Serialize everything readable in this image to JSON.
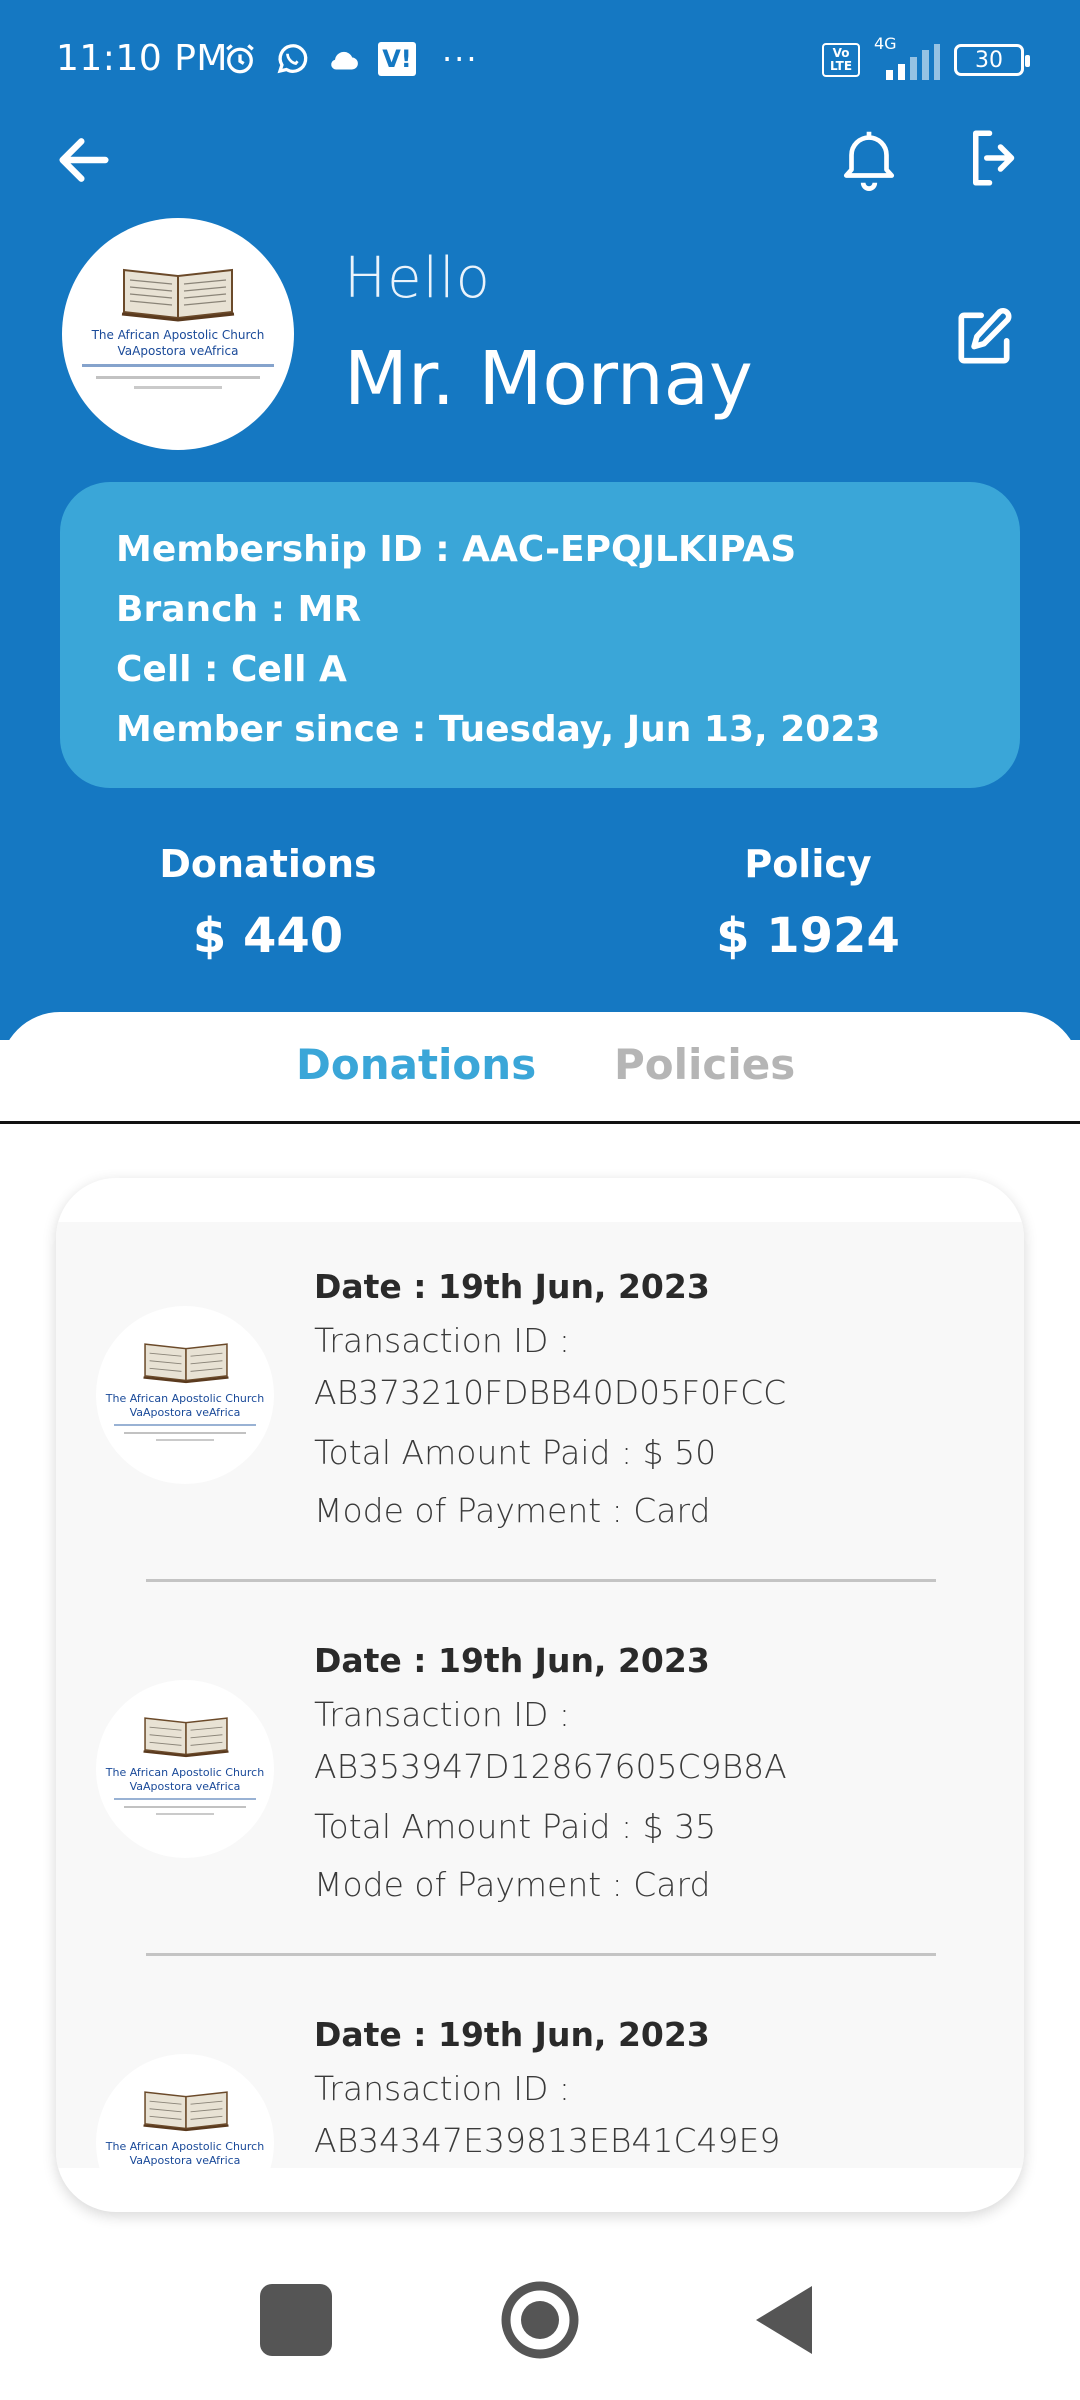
{
  "status_bar": {
    "time": "11:10 PM",
    "network": "4G",
    "battery": "30",
    "volte": "Vo LTE",
    "vi": "V!",
    "more": "···"
  },
  "profile": {
    "greeting": "Hello",
    "name": "Mr. Mornay",
    "logo_line1": "The African Apostolic Church",
    "logo_line2": "VaApostora veAfrica"
  },
  "membership": {
    "id_line": "Membership ID : AAC-EPQJLKIPAS",
    "branch_line": "Branch : MR",
    "cell_line": "Cell : Cell A",
    "since_line": "Member since : Tuesday, Jun 13, 2023"
  },
  "totals": {
    "donations_label": "Donations",
    "donations_value": "$ 440",
    "policy_label": "Policy",
    "policy_value": "$ 1924"
  },
  "tabs": {
    "active": "Donations",
    "inactive": "Policies"
  },
  "transactions": [
    {
      "date": "Date :  19th Jun, 2023",
      "tid_label": "Transaction ID :",
      "tid_value": "AB373210FDBB40D05F0FCC",
      "amount": "Total Amount Paid :  $ 50",
      "mode": "Mode of Payment :  Card"
    },
    {
      "date": "Date :  19th Jun, 2023",
      "tid_label": "Transaction ID :",
      "tid_value": "AB353947D12867605C9B8A",
      "amount": "Total Amount Paid :  $ 35",
      "mode": "Mode of Payment :  Card"
    },
    {
      "date": "Date :  19th Jun, 2023",
      "tid_label": "Transaction ID :",
      "tid_value": "AB34347E39813EB41C49E9",
      "amount": "",
      "mode": ""
    }
  ],
  "colors": {
    "header_blue": "#1578c2",
    "card_blue": "#3aa6d8",
    "tab_active": "#3aa6d8",
    "tab_inactive": "#b5b5b5"
  }
}
